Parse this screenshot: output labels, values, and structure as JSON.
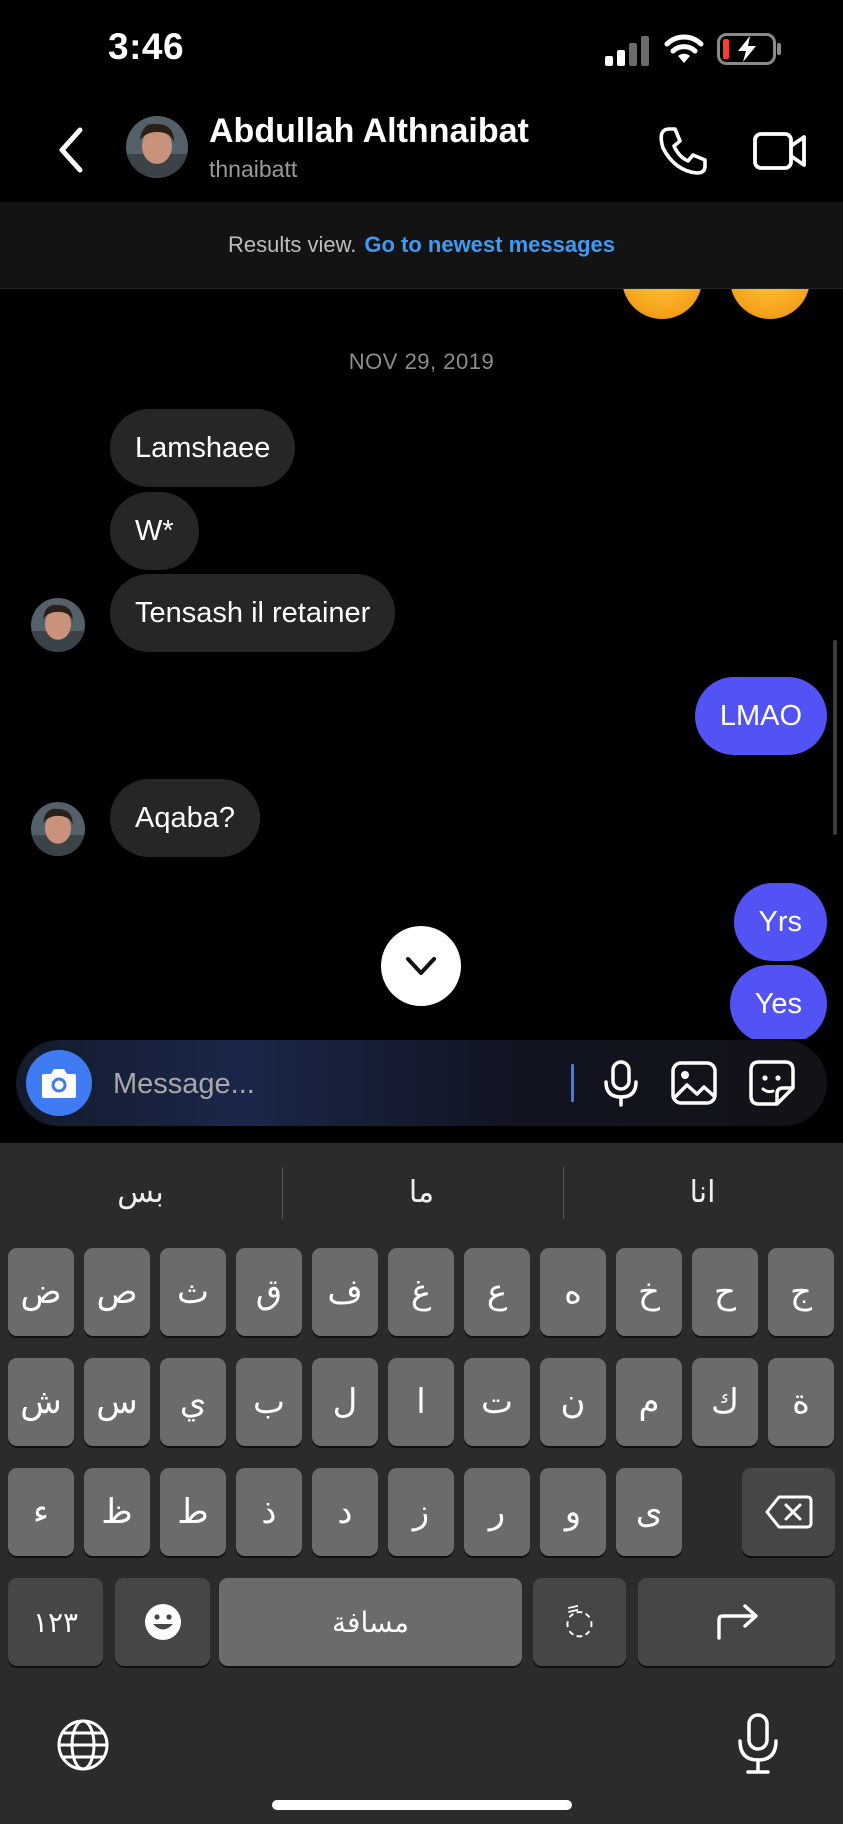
{
  "status_bar": {
    "time": "3:46"
  },
  "header": {
    "contact_name": "Abdullah Althnaibat",
    "contact_handle": "thnaibatt",
    "back_icon": "chevron-left-icon",
    "call_icon": "phone-icon",
    "video_icon": "video-camera-icon"
  },
  "results_banner": {
    "text": "Results view.",
    "link": "Go to newest messages"
  },
  "messages": {
    "date": "NOV 29, 2019",
    "items": [
      {
        "from": "them",
        "text": "Lamshaee"
      },
      {
        "from": "them",
        "text": "W*"
      },
      {
        "from": "them",
        "text": "Tensash il retainer"
      },
      {
        "from": "me",
        "text": "LMAO"
      },
      {
        "from": "them",
        "text": "Aqaba?"
      },
      {
        "from": "me",
        "text": "Yrs"
      },
      {
        "from": "me",
        "text": "Yes"
      }
    ]
  },
  "composer": {
    "placeholder": "Message...",
    "camera_icon": "camera-icon",
    "mic_icon": "microphone-icon",
    "gallery_icon": "image-icon",
    "sticker_icon": "sticker-icon"
  },
  "keyboard": {
    "suggestions": [
      "بس",
      "ما",
      "انا"
    ],
    "row1": [
      "ض",
      "ص",
      "ث",
      "ق",
      "ف",
      "غ",
      "ع",
      "ه",
      "خ",
      "ح",
      "ج"
    ],
    "row2": [
      "ش",
      "س",
      "ي",
      "ب",
      "ل",
      "ا",
      "ت",
      "ن",
      "م",
      "ك",
      "ة"
    ],
    "row3": [
      "ء",
      "ظ",
      "ط",
      "ذ",
      "د",
      "ز",
      "ر",
      "و",
      "ى"
    ],
    "numbers_key": "١٢٣",
    "space_key": "مسافة",
    "diacritic_key": "◌ً",
    "emoji_icon": "emoji-icon",
    "return_icon": "return-arrow-icon",
    "delete_icon": "delete-icon",
    "globe_icon": "globe-icon",
    "dictation_icon": "microphone-icon"
  },
  "colors": {
    "accent_blue": "#3f7cf4",
    "outgoing_bubble": "#5252f5",
    "incoming_bubble": "#262627",
    "link_blue": "#3d9af5"
  }
}
